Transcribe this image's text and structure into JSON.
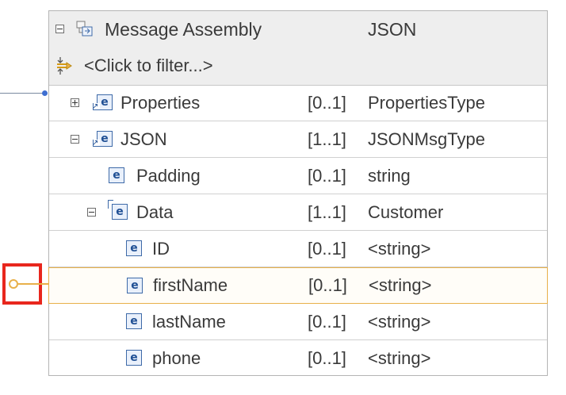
{
  "header": {
    "title": "Message Assembly",
    "type": "JSON",
    "filter_placeholder": "<Click to filter...>"
  },
  "rows": [
    {
      "name": "Properties",
      "cardinality": "[0..1]",
      "type": "PropertiesType",
      "expander": "plus",
      "icon": "element-ref-icon"
    },
    {
      "name": "JSON",
      "cardinality": "[1..1]",
      "type": "JSONMsgType",
      "expander": "minus",
      "icon": "element-ref-icon"
    },
    {
      "name": "Padding",
      "cardinality": "[0..1]",
      "type": "string",
      "icon": "element-icon"
    },
    {
      "name": "Data",
      "cardinality": "[1..1]",
      "type": "Customer",
      "expander": "minus",
      "icon": "element-group-icon"
    },
    {
      "name": "ID",
      "cardinality": "[0..1]",
      "type": "<string>",
      "icon": "element-icon"
    },
    {
      "name": "firstName",
      "cardinality": "[0..1]",
      "type": "<string>",
      "icon": "element-icon",
      "selected": true
    },
    {
      "name": "lastName",
      "cardinality": "[0..1]",
      "type": "<string>",
      "icon": "element-icon"
    },
    {
      "name": "phone",
      "cardinality": "[0..1]",
      "type": "<string>",
      "icon": "element-icon"
    }
  ],
  "colors": {
    "selection_border": "#e8b04a",
    "highlight_box": "#e8261d",
    "connector_dot": "#3f6fd1"
  }
}
